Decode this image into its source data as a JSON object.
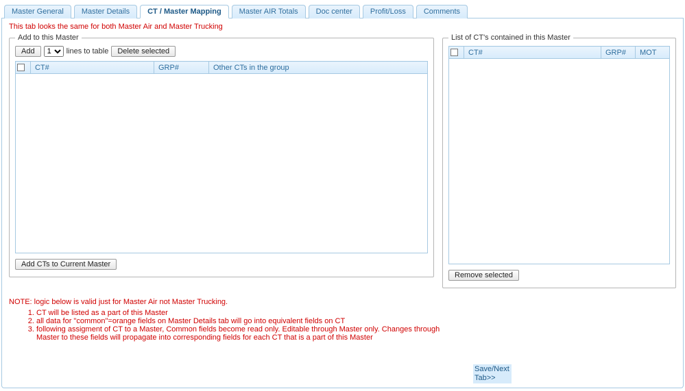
{
  "tabs": [
    {
      "label": "Master General"
    },
    {
      "label": "Master Details"
    },
    {
      "label": "CT / Master Mapping"
    },
    {
      "label": "Master AIR Totals"
    },
    {
      "label": "Doc center"
    },
    {
      "label": "Profit/Loss"
    },
    {
      "label": "Comments"
    }
  ],
  "hint_top": "This tab looks the same for both Master Air and Master Trucking",
  "left": {
    "legend": "Add to this Master",
    "add_btn": "Add",
    "qty_value": "1",
    "lines_label": "lines to table",
    "delete_btn": "Delete selected",
    "cols": {
      "ct": "CT#",
      "grp": "GRP#",
      "other": "Other CTs in the group"
    },
    "add_cts_btn": "Add CTs to Current Master"
  },
  "right": {
    "legend": "List of CT's contained in this Master",
    "cols": {
      "ct": "CT#",
      "grp": "GRP#",
      "mot": "MOT"
    },
    "remove_btn": "Remove selected"
  },
  "notes_heading": "NOTE: logic below is valid just for Master Air not Master Trucking.",
  "notes": [
    "CT will be listed as a part of this Master",
    "all data for \"common\"=orange fields on Master Details tab will go into equivalent fields on CT",
    "following assigment of CT to a Master, Common fields become read only. Editable through Master only. Changes through Master to these fields will propagate into corresponding fields for each CT that is a part of this Master"
  ],
  "save_next": "Save/Next Tab>>"
}
